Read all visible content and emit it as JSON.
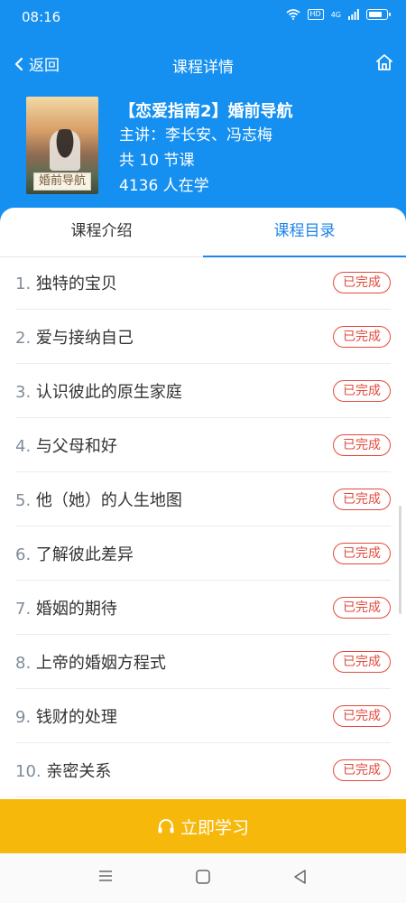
{
  "status_bar": {
    "time": "08:16",
    "hd_badge": "HD",
    "network": "4G",
    "battery_level": 0.85
  },
  "nav": {
    "back_label": "返回",
    "title": "课程详情",
    "home_icon": "home-icon"
  },
  "course": {
    "cover_caption": "婚前导航",
    "title": "【恋爱指南2】婚前导航",
    "lecturer": "主讲：李长安、冯志梅",
    "lessons_count": "共 10 节课",
    "learners": "4136 人在学"
  },
  "tabs": [
    {
      "label": "课程介绍",
      "active": false
    },
    {
      "label": "课程目录",
      "active": true
    }
  ],
  "lessons": [
    {
      "num": "1.",
      "title": "独特的宝贝",
      "status": "已完成"
    },
    {
      "num": "2.",
      "title": "爱与接纳自己",
      "status": "已完成"
    },
    {
      "num": "3.",
      "title": "认识彼此的原生家庭",
      "status": "已完成"
    },
    {
      "num": "4.",
      "title": "与父母和好",
      "status": "已完成"
    },
    {
      "num": "5.",
      "title": "他（她）的人生地图",
      "status": "已完成"
    },
    {
      "num": "6.",
      "title": "了解彼此差异",
      "status": "已完成"
    },
    {
      "num": "7.",
      "title": "婚姻的期待",
      "status": "已完成"
    },
    {
      "num": "8.",
      "title": "上帝的婚姻方程式",
      "status": "已完成"
    },
    {
      "num": "9.",
      "title": "钱财的处理",
      "status": "已完成"
    },
    {
      "num": "10.",
      "title": "亲密关系",
      "status": "已完成"
    }
  ],
  "action": {
    "study_label": "立即学习",
    "icon": "headphones-icon"
  },
  "colors": {
    "header_blue": "#1690f0",
    "tab_active": "#1d84e8",
    "badge_red": "#e24a3c",
    "cta_yellow": "#f7b80c"
  }
}
